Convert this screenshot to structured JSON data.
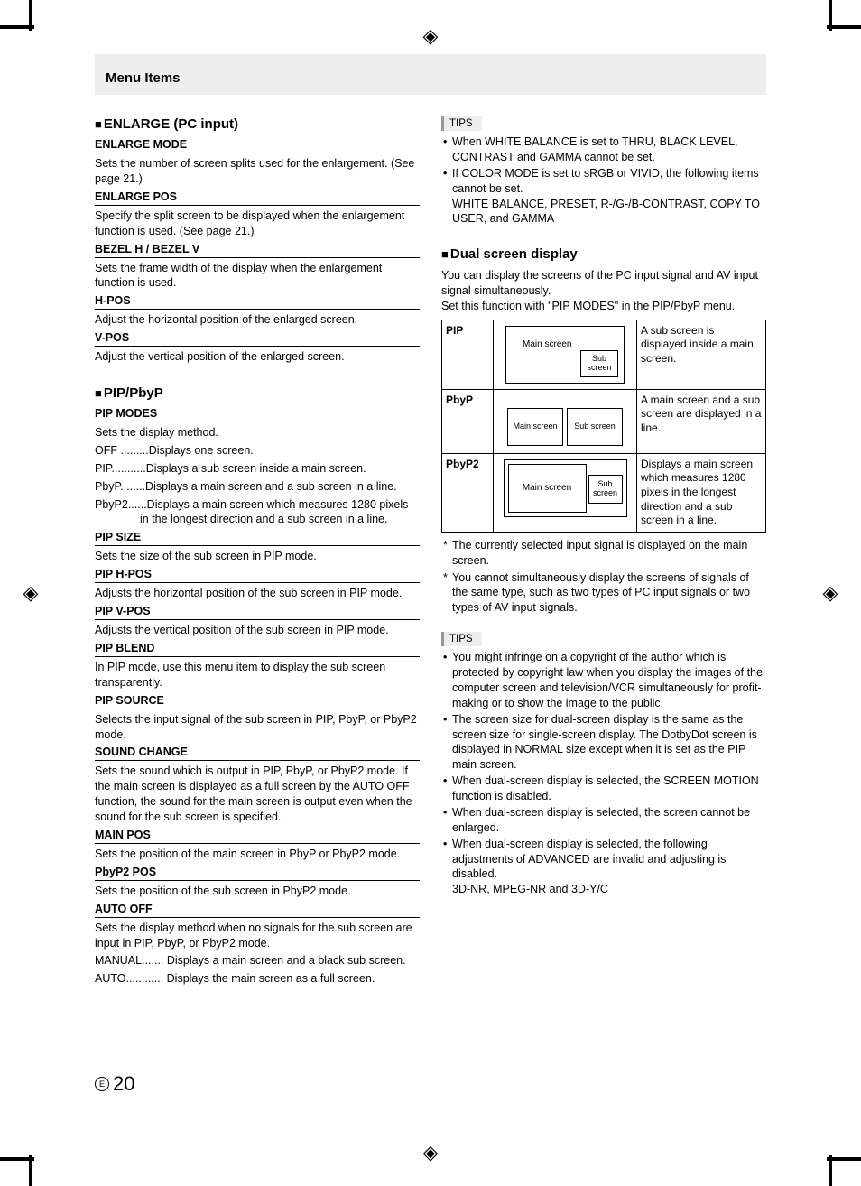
{
  "header": {
    "title": "Menu Items"
  },
  "left": {
    "enlarge": {
      "title": "ENLARGE (PC input)",
      "items": [
        {
          "name": "ENLARGE MODE",
          "desc": "Sets the number of screen splits used for the enlargement. (See page 21.)"
        },
        {
          "name": "ENLARGE POS",
          "desc": "Specify the split screen to be displayed when the enlargement function is used. (See page 21.)"
        },
        {
          "name": "BEZEL H / BEZEL V",
          "desc": "Sets the frame width of the display when the enlargement function is used."
        },
        {
          "name": "H-POS",
          "desc": "Adjust the horizontal position of the enlarged screen."
        },
        {
          "name": "V-POS",
          "desc": "Adjust the vertical position of the enlarged screen."
        }
      ]
    },
    "pip": {
      "title": "PIP/PbyP",
      "modes_title": "PIP MODES",
      "modes_intro": "Sets the display method.",
      "modes_lines": [
        "OFF .........Displays one screen.",
        "PIP...........Displays a sub screen inside a main screen.",
        "PbyP........Displays a main screen and a sub screen in a line.",
        "PbyP2......Displays a main screen which measures 1280 pixels in the longest direction and a sub screen in a line."
      ],
      "items": [
        {
          "name": "PIP SIZE",
          "desc": "Sets the size of the sub screen in PIP mode."
        },
        {
          "name": "PIP H-POS",
          "desc": "Adjusts the horizontal position of the sub screen in PIP mode."
        },
        {
          "name": "PIP V-POS",
          "desc": "Adjusts the vertical position of the sub screen in PIP mode."
        },
        {
          "name": "PIP BLEND",
          "desc": "In PIP mode, use this menu item to display the sub screen transparently."
        },
        {
          "name": "PIP SOURCE",
          "desc": "Selects the input signal of the sub screen in PIP, PbyP, or PbyP2 mode."
        },
        {
          "name": "SOUND CHANGE",
          "desc": "Sets the sound which is output in PIP, PbyP, or PbyP2 mode. If the main screen is displayed as a full screen by the AUTO OFF function, the sound for the main screen is output even when the sound for the sub screen is specified."
        },
        {
          "name": "MAIN POS",
          "desc": "Sets the position of the main screen in PbyP or PbyP2 mode."
        },
        {
          "name": "PbyP2 POS",
          "desc": "Sets the position of the sub screen in PbyP2 mode."
        }
      ],
      "autooff": {
        "name": "AUTO OFF",
        "desc": "Sets the display method when no signals for the sub screen are input in PIP, PbyP, or PbyP2 mode.",
        "lines": [
          "MANUAL....... Displays a main screen and a black sub screen.",
          "AUTO............ Displays the main screen as a full screen."
        ]
      }
    }
  },
  "right": {
    "tips1": {
      "label": "TIPS",
      "bullets": [
        "When WHITE BALANCE is set to THRU, BLACK LEVEL, CONTRAST and GAMMA cannot be set.",
        "If COLOR MODE is set to sRGB or VIVID, the following items cannot be set.\nWHITE BALANCE, PRESET, R-/G-/B-CONTRAST, COPY TO USER, and GAMMA"
      ]
    },
    "dual": {
      "title": "Dual screen display",
      "intro": "You can display the screens of the PC input signal and AV input signal simultaneously.\nSet this function with \"PIP MODES\" in the PIP/PbyP menu.",
      "table": [
        {
          "name": "PIP",
          "main": "Main screen",
          "sub": "Sub screen",
          "desc": "A sub screen is displayed inside a main screen."
        },
        {
          "name": "PbyP",
          "main": "Main screen",
          "sub": "Sub screen",
          "desc": "A main screen and a sub screen are displayed in a line."
        },
        {
          "name": "PbyP2",
          "main": "Main screen",
          "sub": "Sub screen",
          "desc": "Displays a main screen which measures 1280 pixels in the longest direction and a sub screen in a line."
        }
      ],
      "stars": [
        "The currently selected input signal is displayed on the main screen.",
        "You cannot simultaneously display the screens of signals of the same type, such as two types of PC input signals or two types of AV input signals."
      ]
    },
    "tips2": {
      "label": "TIPS",
      "bullets": [
        "You might infringe on a copyright of the author which is protected by copyright law when you display the images of the computer screen and television/VCR simultaneously for profit-making or to show the image to the public.",
        "The screen size for dual-screen display is the same as the screen size for single-screen display. The DotbyDot screen is displayed in NORMAL size except when it is set as the PIP main screen.",
        "When dual-screen display is selected, the SCREEN MOTION function is disabled.",
        "When dual-screen display is selected, the screen cannot be enlarged.",
        "When dual-screen display is selected, the following adjustments of ADVANCED are invalid and adjusting is disabled.\n3D-NR, MPEG-NR and 3D-Y/C"
      ]
    }
  },
  "footer": {
    "e": "E",
    "page": "20"
  }
}
